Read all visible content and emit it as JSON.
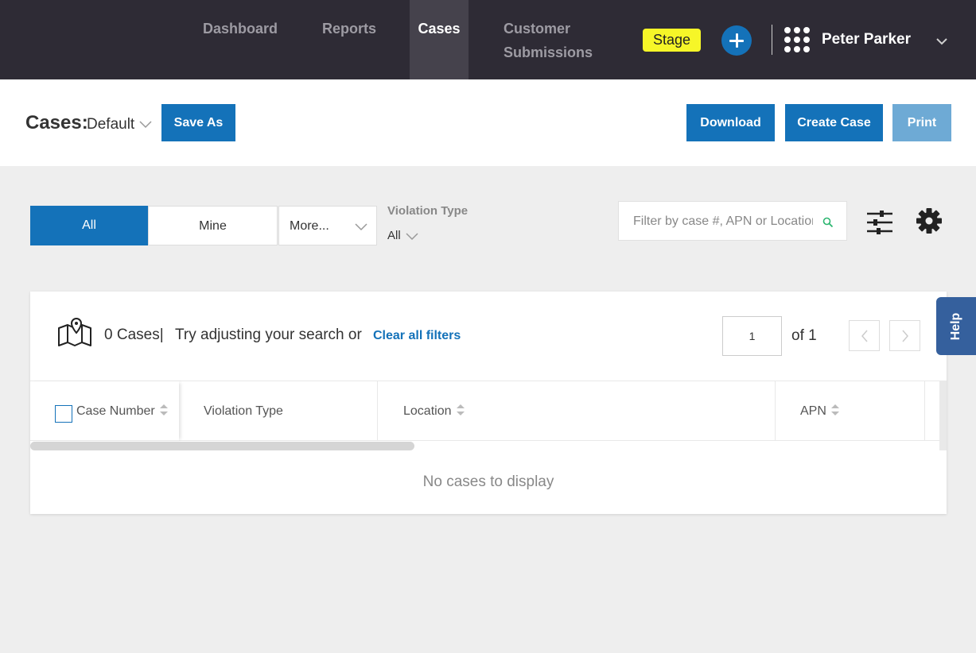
{
  "nav": {
    "items": [
      {
        "label": "Dashboard"
      },
      {
        "label": "Reports"
      },
      {
        "label": "Cases"
      },
      {
        "label": "Customer Submissions"
      }
    ],
    "active": "Cases",
    "stage_badge": "Stage",
    "user_name": "Peter Parker",
    "colors": {
      "background": "#2e2b35",
      "active_tab": "#45424c",
      "badge": "#f6f628",
      "accent": "#1472b9"
    }
  },
  "header": {
    "title": "Cases:",
    "view_name": "Default",
    "save_as_label": "Save As",
    "download_label": "Download",
    "create_case_label": "Create Case",
    "print_label": "Print"
  },
  "filters": {
    "segments": [
      {
        "label": "All",
        "selected": true
      },
      {
        "label": "Mine",
        "selected": false
      },
      {
        "label": "More...",
        "selected": false
      }
    ],
    "violation_type": {
      "label": "Violation Type",
      "value": "All"
    },
    "search_placeholder": "Filter by case #, APN or Location"
  },
  "results": {
    "count_text": "0 Cases|",
    "hint_text": "Try adjusting your search or",
    "clear_link": "Clear all filters",
    "page_value": "1",
    "page_of": "of 1",
    "columns": [
      "Case Number",
      "Violation Type",
      "Location",
      "APN"
    ],
    "empty_message": "No cases to display"
  },
  "help": {
    "label": "Help"
  },
  "icons": [
    "plus-icon",
    "apps-grid-icon",
    "chevron-down-icon",
    "search-icon",
    "sliders-icon",
    "gear-icon",
    "map-pin-icon",
    "chevron-left-icon",
    "chevron-right-icon",
    "sort-icon"
  ]
}
